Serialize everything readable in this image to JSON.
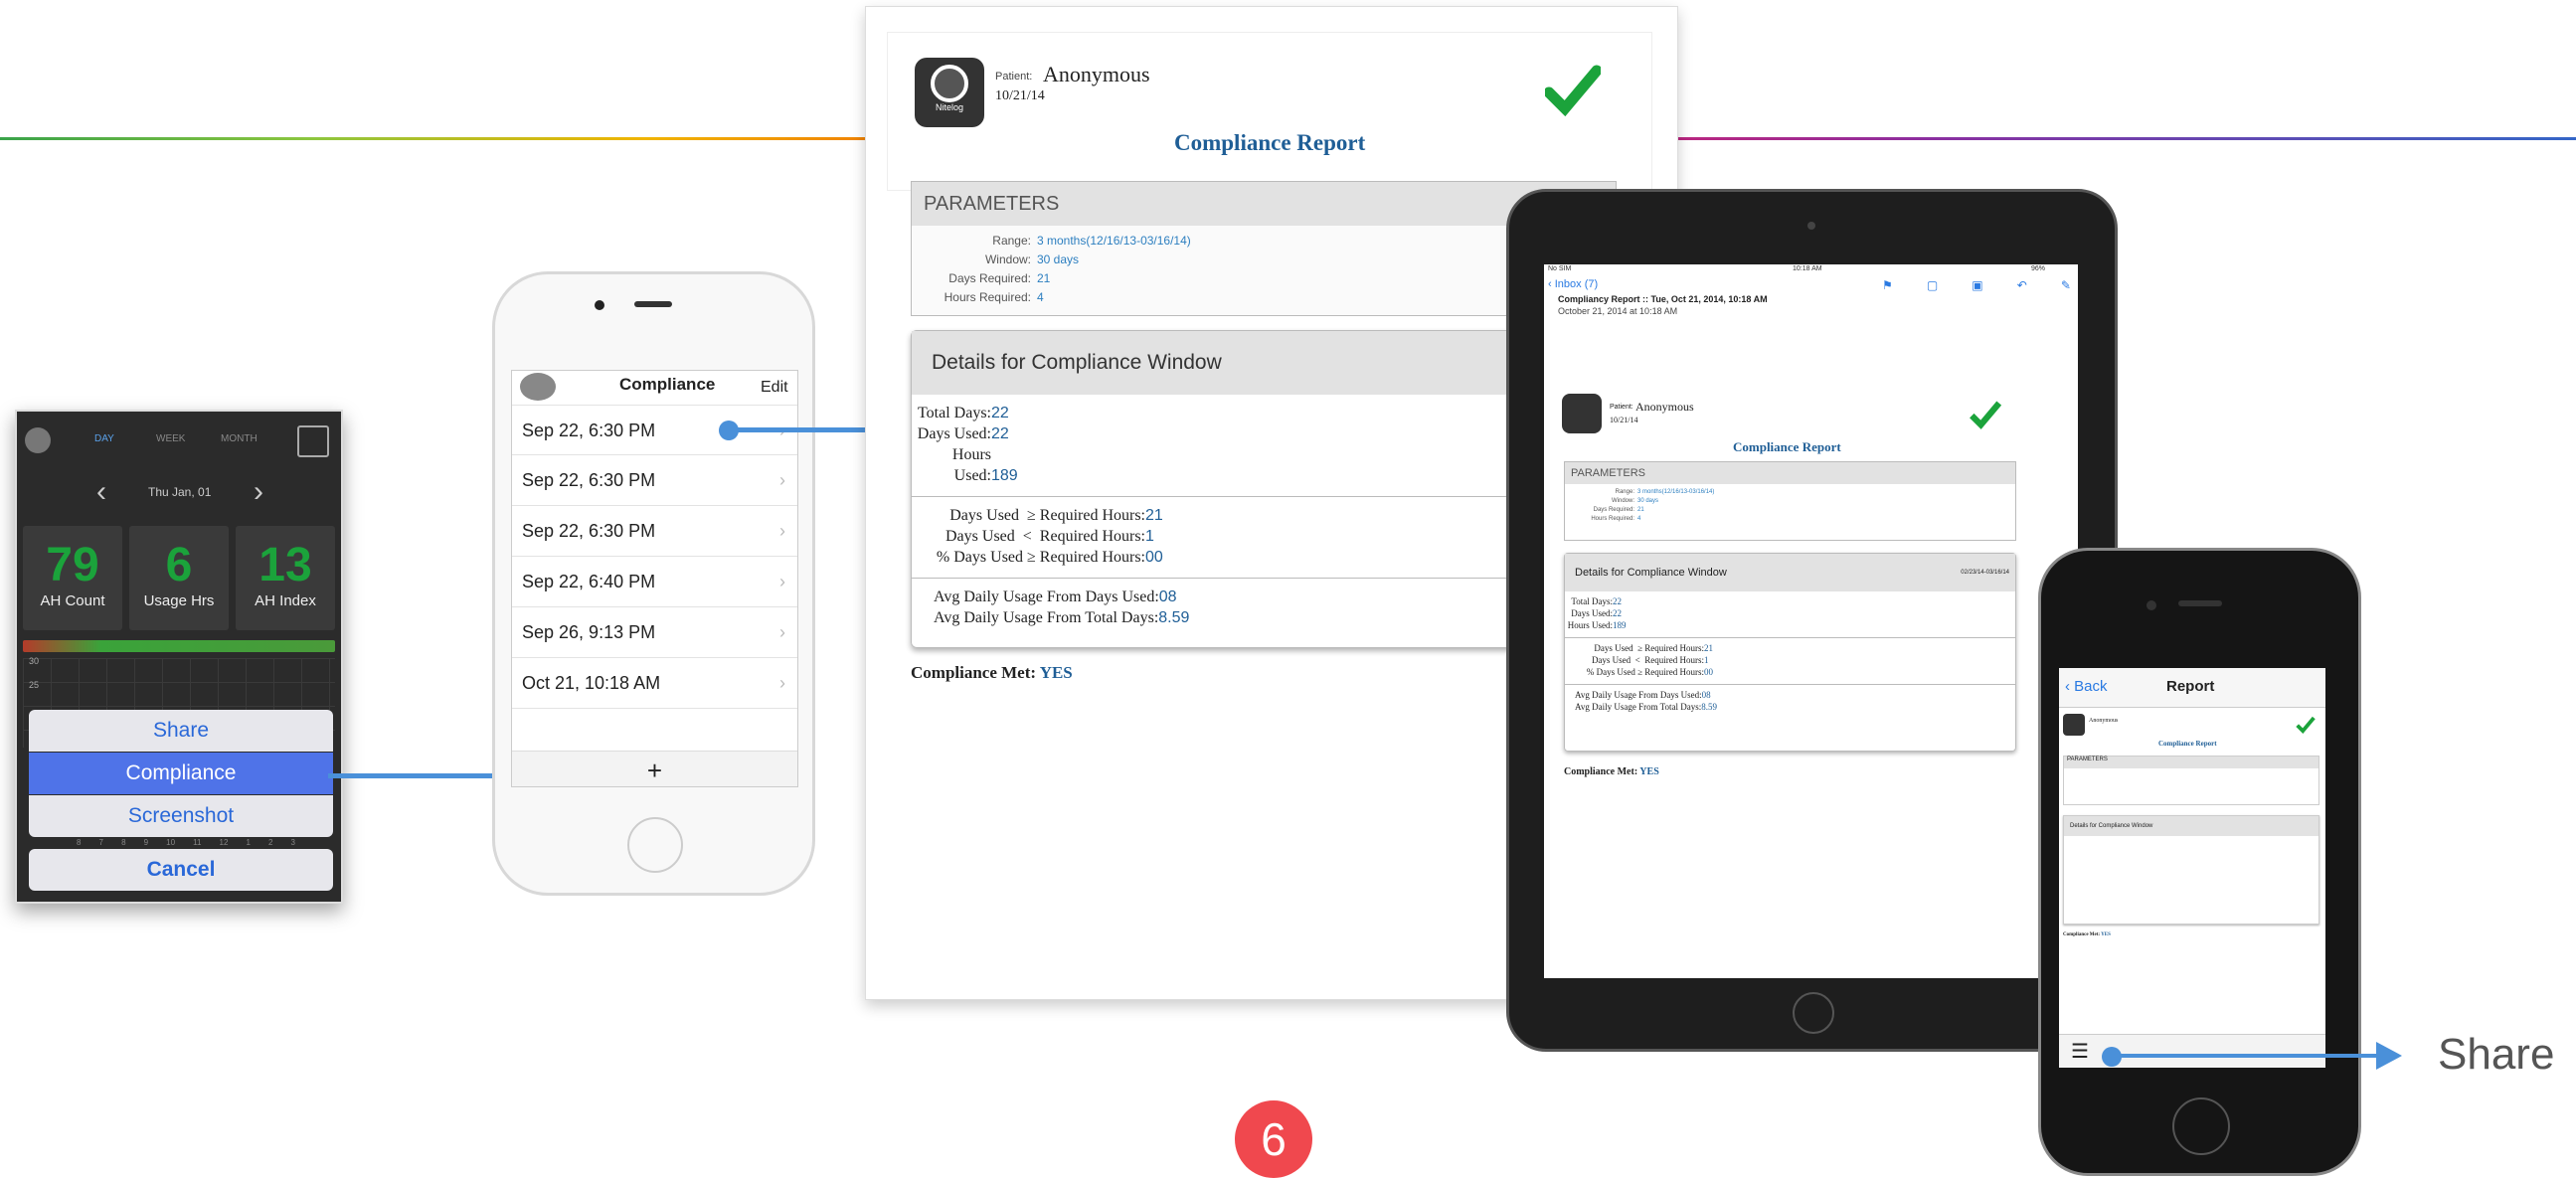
{
  "step_number": "6",
  "share_callout": "Share",
  "colors": {
    "accent": "#4a90d9",
    "green": "#1ba33b",
    "badge": "#f0484e"
  },
  "phone1": {
    "tabs": [
      "DAY",
      "WEEK",
      "MONTH"
    ],
    "date": "Thu Jan, 01",
    "tiles": [
      {
        "value": "79",
        "label": "AH Count"
      },
      {
        "value": "6",
        "label": "Usage Hrs"
      },
      {
        "value": "13",
        "label": "AH Index"
      }
    ],
    "y_ticks": [
      "30",
      "25"
    ],
    "x_ticks": [
      "8",
      "7",
      "8",
      "9",
      "10",
      "11",
      "12",
      "1",
      "2",
      "3"
    ],
    "actions": {
      "share": "Share",
      "compliance": "Compliance",
      "screenshot": "Screenshot",
      "cancel": "Cancel"
    }
  },
  "phone2": {
    "title": "Compliance",
    "edit": "Edit",
    "items": [
      "Sep 22, 6:30 PM",
      "Sep 22, 6:30 PM",
      "Sep 22, 6:30 PM",
      "Sep 22, 6:40 PM",
      "Sep 26, 9:13 PM",
      "Oct 21, 10:18 AM"
    ],
    "add": "+"
  },
  "report": {
    "app_name": "Nitelog",
    "patient_label": "Patient:",
    "patient_name": "Anonymous",
    "date": "10/21/14",
    "title": "Compliance Report",
    "params_header": "PARAMETERS",
    "params": [
      {
        "k": "Range:",
        "v": "3 months(12/16/13-03/16/14)"
      },
      {
        "k": "Window:",
        "v": "30 days"
      },
      {
        "k": "Days Required:",
        "v": "21"
      },
      {
        "k": "Hours Required:",
        "v": "4"
      }
    ],
    "details_header": "Details for Compliance Window",
    "details_range": "02/23/14-03/16/14",
    "group1": [
      {
        "k": "Total Days:",
        "v": "22"
      },
      {
        "k": "Days Used:",
        "v": "22"
      },
      {
        "k": "Hours Used:",
        "v": "189"
      }
    ],
    "group2": [
      {
        "k": "Days Used  ≥ Required Hours:",
        "v": "21"
      },
      {
        "k": "Days Used  <  Required Hours:",
        "v": "1"
      },
      {
        "k": "% Days Used ≥ Required Hours:",
        "v": "00"
      }
    ],
    "group3": [
      {
        "k": "Avg Daily Usage From Days Used:",
        "v": "08"
      },
      {
        "k": "Avg Daily Usage From Total Days:",
        "v": "8.59"
      }
    ],
    "met_label": "Compliance Met:",
    "met_value": "YES"
  },
  "ipad": {
    "status_left": "No SIM",
    "status_time": "10:18 AM",
    "status_right": "96%",
    "inbox": "Inbox (7)",
    "subject": "Compliancy Report :: Tue, Oct 21, 2014, 10:18 AM",
    "sent": "October 21, 2014 at 10:18 AM"
  },
  "phone3": {
    "back": "Back",
    "title": "Report"
  }
}
